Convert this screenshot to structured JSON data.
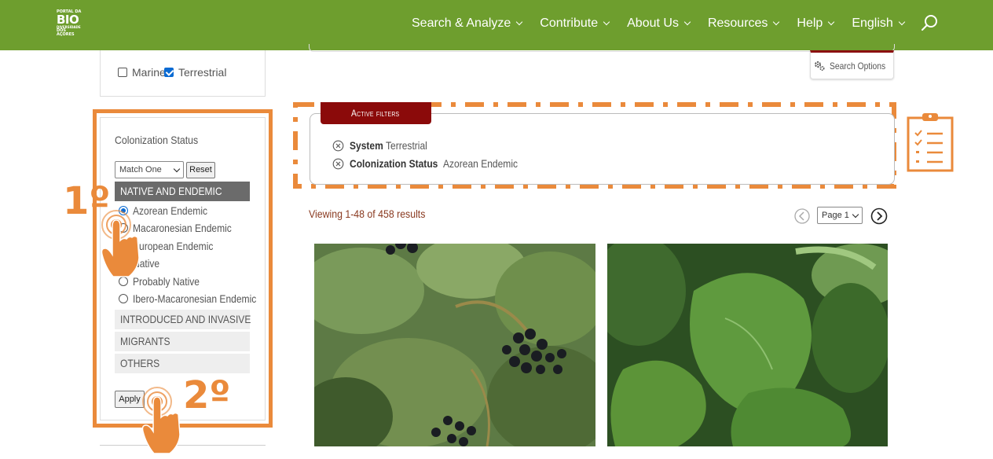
{
  "nav": {
    "logo": {
      "line1": "PORTAL DA",
      "line2": "BIO",
      "line3": "DIVERSIDADE",
      "line4": "DOS AÇORES"
    },
    "menu": [
      {
        "label": "Search & Analyze"
      },
      {
        "label": "Contribute"
      },
      {
        "label": "About Us"
      },
      {
        "label": "Resources"
      },
      {
        "label": "Help"
      },
      {
        "label": "English"
      }
    ],
    "search_icon": "search-icon"
  },
  "system_filter": {
    "options": [
      {
        "label": "Marine",
        "checked": false
      },
      {
        "label": "Terrestrial",
        "checked": true
      }
    ]
  },
  "colonization": {
    "title": "Colonization Status",
    "match_select": "Match One",
    "reset_label": "Reset",
    "groups": [
      {
        "label": "NATIVE AND ENDEMIC",
        "expanded": true,
        "options": [
          {
            "label": "Azorean Endemic",
            "selected": true
          },
          {
            "label": "Macaronesian Endemic",
            "selected": false
          },
          {
            "label": "European Endemic",
            "selected": false
          },
          {
            "label": "Native",
            "selected": false
          },
          {
            "label": "Probably Native",
            "selected": false
          },
          {
            "label": "Ibero-Macaronesian Endemic",
            "selected": false
          }
        ]
      },
      {
        "label": "INTRODUCED AND INVASIVE",
        "expanded": false
      },
      {
        "label": "MIGRANTS",
        "expanded": false
      },
      {
        "label": "OTHERS",
        "expanded": false
      }
    ],
    "apply_label": "Apply"
  },
  "annotations": {
    "step1": "1º",
    "step2": "2º",
    "accent_color": "#ea8a3b"
  },
  "search_options": {
    "label": "Search Options",
    "icon": "gear-icon"
  },
  "active_filters": {
    "tab_label": "Active filters",
    "filters": [
      {
        "key": "System",
        "value": "Terrestrial"
      },
      {
        "key": "Colonization Status",
        "value": "Azorean Endemic"
      }
    ],
    "icon": "clipboard-checklist-icon"
  },
  "results": {
    "summary": "Viewing 1-48 of 458 results",
    "page_select": "Page 1"
  },
  "colors": {
    "nav_green": "#6e9e2e",
    "filter_tab_red": "#8b0a0a",
    "results_text": "#8a3a20",
    "selected_blue": "#0b6bd3"
  }
}
